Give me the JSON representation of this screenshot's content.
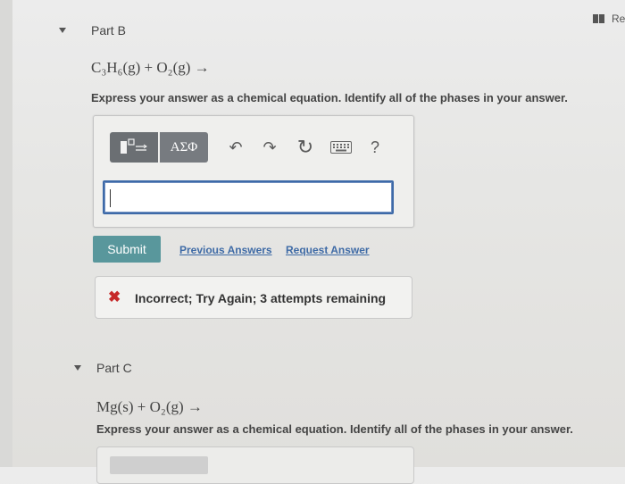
{
  "header": {
    "review_label": "Re"
  },
  "part_b": {
    "title": "Part B",
    "equation": "C₃H₆(g) + O₂(g) →",
    "instructions": "Express your answer as a chemical equation. Identify all of the phases in your answer.",
    "toolbar": {
      "greek_label": "ΑΣΦ",
      "undo_symbol": "↶",
      "redo_symbol": "↷",
      "reset_symbol": "↻",
      "help_label": "?"
    },
    "answer_value": "",
    "submit_label": "Submit",
    "previous_answers_label": "Previous Answers",
    "request_answer_label": "Request Answer",
    "feedback_text": "Incorrect; Try Again; 3 attempts remaining"
  },
  "part_c": {
    "title": "Part C",
    "equation": "Mg(s) + O₂(g) →",
    "instructions": "Express your answer as a chemical equation. Identify all of the phases in your answer."
  },
  "colors": {
    "submit": "#59979c",
    "link": "#3f6ba6",
    "error": "#c62828",
    "input_border": "#3e6aa8"
  }
}
